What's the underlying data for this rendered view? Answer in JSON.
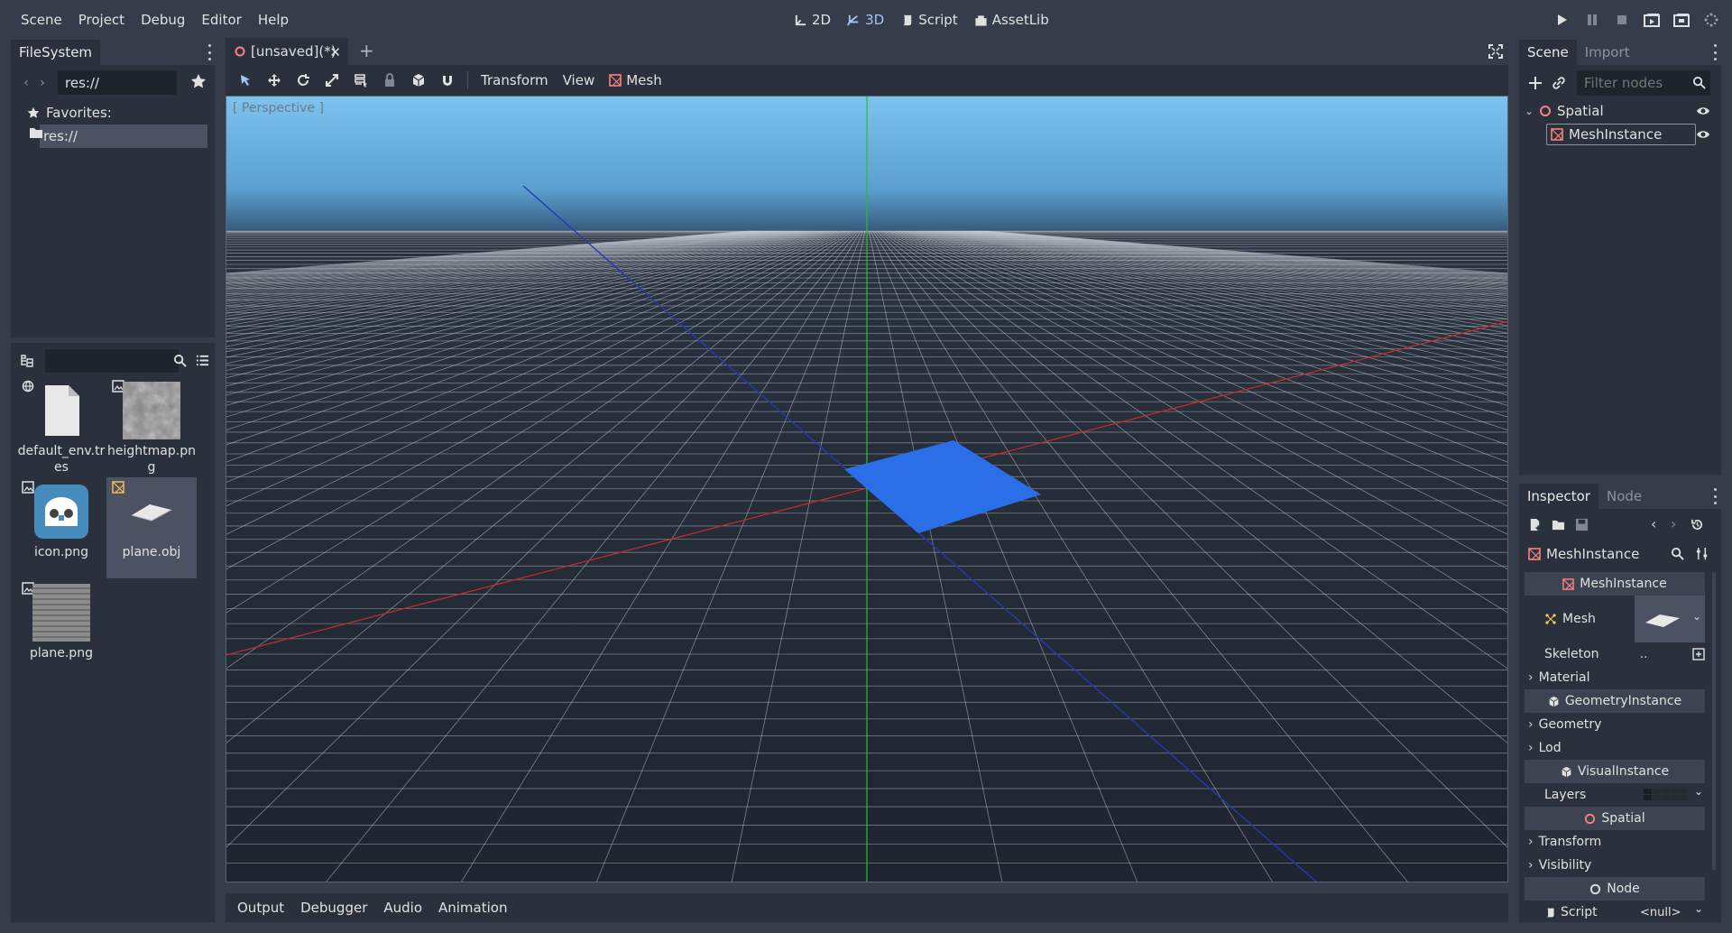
{
  "menubar": {
    "menus": [
      "Scene",
      "Project",
      "Debug",
      "Editor",
      "Help"
    ],
    "workspaces": [
      {
        "label": "2D",
        "icon": "2d-icon",
        "active": false
      },
      {
        "label": "3D",
        "icon": "3d-icon",
        "active": true
      },
      {
        "label": "Script",
        "icon": "script-icon",
        "active": false
      },
      {
        "label": "AssetLib",
        "icon": "assetlib-icon",
        "active": false
      }
    ],
    "run_controls": [
      "play-icon",
      "pause-icon",
      "stop-icon",
      "play-scene-icon",
      "play-custom-scene-icon",
      "spinner-icon"
    ]
  },
  "filesystem": {
    "tab": "FileSystem",
    "path": "res://",
    "tree": {
      "favorites_label": "Favorites:",
      "root_label": "res://"
    },
    "filter_placeholder": "",
    "files": [
      {
        "name": "default_env.tres",
        "icon": "resource-file-icon",
        "badge": "environment-icon",
        "selected": false
      },
      {
        "name": "heightmap.png",
        "icon": "noise-texture-thumb",
        "badge": "texture-icon",
        "selected": false
      },
      {
        "name": "icon.png",
        "icon": "godot-logo-thumb",
        "badge": "texture-icon",
        "selected": false
      },
      {
        "name": "plane.obj",
        "icon": "plane-mesh-thumb",
        "badge": "mesh-icon",
        "selected": true
      },
      {
        "name": "plane.png",
        "icon": "striped-texture-thumb",
        "badge": "texture-icon",
        "selected": false
      }
    ]
  },
  "editor": {
    "scene_tab": "[unsaved](*)",
    "toolbar_menus": [
      "Transform",
      "View",
      "Mesh"
    ],
    "viewport_label": "[ Perspective ]",
    "colors": {
      "x_axis": "#cc2a2a",
      "y_axis": "#22c322",
      "z_axis": "#2438b8",
      "plane": "#2a6fe8",
      "sky_top": "#7cc3ef",
      "horizon": "#1e2530"
    }
  },
  "bottom_panel": {
    "tabs": [
      "Output",
      "Debugger",
      "Audio",
      "Animation"
    ]
  },
  "scene_dock": {
    "tabs": [
      "Scene",
      "Import"
    ],
    "filter_placeholder": "Filter nodes",
    "nodes": [
      {
        "name": "Spatial",
        "icon": "spatial-node-icon",
        "depth": 0,
        "selected": false
      },
      {
        "name": "MeshInstance",
        "icon": "meshinstance-icon",
        "depth": 1,
        "selected": true
      }
    ]
  },
  "inspector": {
    "tabs": [
      "Inspector",
      "Node"
    ],
    "object_name": "MeshInstance",
    "categories": [
      {
        "header": "MeshInstance",
        "icon": "meshinstance-icon",
        "props": [
          {
            "label": "Mesh",
            "value": "",
            "kind": "mesh-preview"
          },
          {
            "label": "Skeleton",
            "value": "..",
            "kind": "nodepath"
          },
          {
            "label": "Material",
            "value": "",
            "kind": "section"
          }
        ]
      },
      {
        "header": "GeometryInstance",
        "icon": "geometry-icon",
        "props": [
          {
            "label": "Geometry",
            "value": "",
            "kind": "section"
          },
          {
            "label": "Lod",
            "value": "",
            "kind": "section"
          }
        ]
      },
      {
        "header": "VisualInstance",
        "icon": "visual-icon",
        "props": [
          {
            "label": "Layers",
            "value": "",
            "kind": "layers"
          }
        ]
      },
      {
        "header": "Spatial",
        "icon": "spatial-node-icon",
        "props": [
          {
            "label": "Transform",
            "value": "",
            "kind": "section"
          },
          {
            "label": "Visibility",
            "value": "",
            "kind": "section"
          }
        ]
      },
      {
        "header": "Node",
        "icon": "node-icon",
        "props": [
          {
            "label": "Script",
            "value": "<null>",
            "kind": "resource"
          }
        ]
      }
    ]
  }
}
